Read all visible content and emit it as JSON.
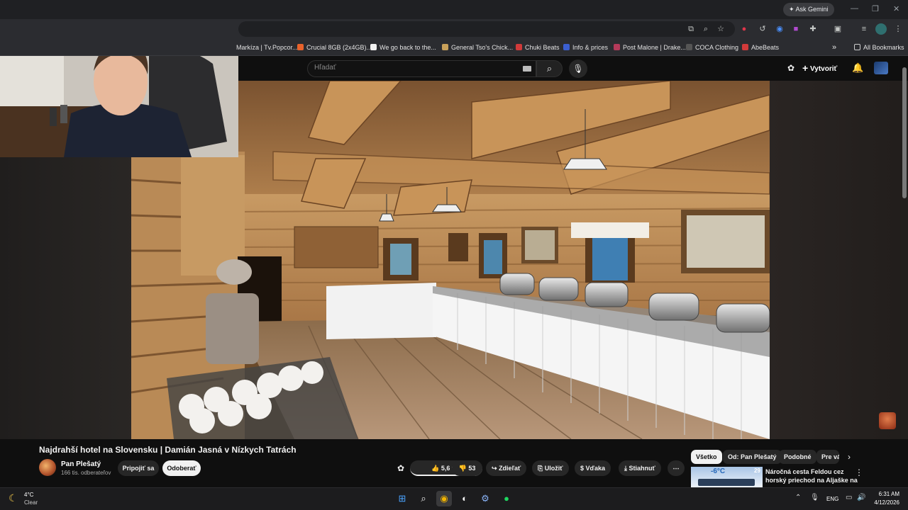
{
  "browser": {
    "ask_gemini": "Ask Gemini",
    "bookmarks": [
      {
        "label": "Markíza | Tv.Popcor...",
        "color": "#e33b3b"
      },
      {
        "label": "Crucial 8GB (2x4GB)...",
        "color": "#e8622b"
      },
      {
        "label": "We go back to the...",
        "color": "#f1f1f1"
      },
      {
        "label": "General Tso's Chick...",
        "color": "#c9a15a"
      },
      {
        "label": "Chuki Beats",
        "color": "#d13a3a"
      },
      {
        "label": "Info & prices",
        "color": "#3b5fd1"
      },
      {
        "label": "Post Malone | Drake...",
        "color": "#b43a5a"
      },
      {
        "label": "COCA Clothing",
        "color": "#222222"
      },
      {
        "label": "AbeBeats",
        "color": "#d13a3a"
      }
    ],
    "all_bookmarks": "All Bookmarks"
  },
  "youtube": {
    "search_placeholder": "Hľadať",
    "create_label": "Vytvoriť",
    "video": {
      "title": "Najdrahší hotel na Slovensku | Damián Jasná v Nízkych Tatrách",
      "channel": "Pan Plešatý",
      "subscribers": "166 tis. odberateľov",
      "join_label": "Pripojiť sa",
      "subscribe_label": "Odoberať",
      "likes": "5,6 tis.",
      "dislikes": "53",
      "share_label": "Zdieľať",
      "save_label": "Uložiť",
      "thanks_label": "Vďaka",
      "download_label": "Stiahnuť"
    },
    "chips": [
      "Všetko",
      "Od: Pan Plešatý",
      "Podobné",
      "Pre vás"
    ],
    "recommendation": {
      "title": "Náročná cesta Feldou cez horský priechod na Aljaške na ...",
      "badge": "29",
      "thumb_text": "-6°C"
    }
  },
  "taskbar": {
    "temperature": "4°C",
    "weather": "Clear",
    "language": "ENG",
    "time": "6:31 AM",
    "date": "4/12/2026"
  }
}
